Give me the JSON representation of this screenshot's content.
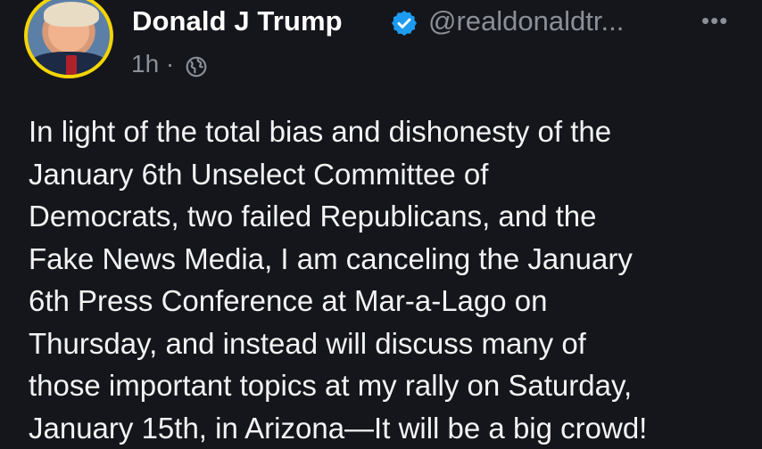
{
  "tweet": {
    "author_name": "Donald J Trump",
    "handle": "@realdonaldtr...",
    "timestamp": "1h ·",
    "more_label": "•••",
    "visibility_icon": "globe-icon",
    "verified_icon": "verified-badge-icon",
    "lines": [
      "In light of the total bias and dishonesty of the",
      "January 6th Unselect Committee of",
      "Democrats, two failed Republicans, and the",
      "Fake News Media, I am canceling the January",
      "6th Press Conference at Mar-a-Lago on",
      "Thursday, and instead will discuss many of",
      "those important topics at my rally on Saturday,",
      "January 15th, in Arizona—It will be a big crowd!"
    ]
  },
  "colors": {
    "background": "#15161c",
    "text": "#f3f3f3",
    "muted": "#8b8f97",
    "verified": "#1d9bf0",
    "avatar_ring": "#f5d500"
  }
}
